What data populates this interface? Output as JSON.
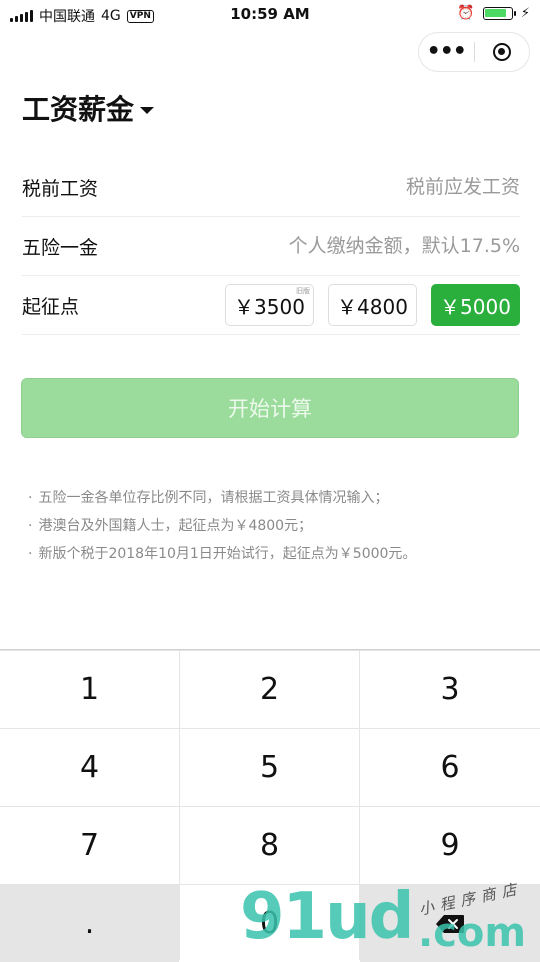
{
  "status_bar": {
    "carrier": "中国联通",
    "network": "4G",
    "vpn": "VPN",
    "time": "10:59 AM",
    "battery_level": 0.85,
    "battery_color": "#4cd964"
  },
  "capsule": {
    "more_glyph": "•••",
    "more_icon": "more-dots-icon",
    "close_icon": "target-circle-icon"
  },
  "header": {
    "title": "工资薪金",
    "dropdown_icon": "caret-down-icon"
  },
  "form": {
    "salary": {
      "label": "税前工资",
      "placeholder": "税前应发工资",
      "value": ""
    },
    "insurance": {
      "label": "五险一金",
      "placeholder": "个人缴纳金额，默认17.5%",
      "value": ""
    },
    "threshold": {
      "label": "起征点",
      "options": [
        {
          "label": "￥3500",
          "tag": "旧版",
          "selected": false
        },
        {
          "label": "￥4800",
          "tag": "",
          "selected": false
        },
        {
          "label": "￥5000",
          "tag": "",
          "selected": true
        }
      ]
    }
  },
  "start_button": {
    "label": "开始计算",
    "enabled": false
  },
  "notes": [
    "五险一金各单位存比例不同，请根据工资具体情况输入；",
    "港澳台及外国籍人士，起征点为￥4800元；",
    "新版个税于2018年10月1日开始试行，起征点为￥5000元。"
  ],
  "note_bullet": "·",
  "keypad": {
    "keys": [
      "1",
      "2",
      "3",
      "4",
      "5",
      "6",
      "7",
      "8",
      "9",
      ".",
      "0"
    ],
    "backspace_icon": "backspace-icon"
  },
  "watermark": {
    "main": "91ud",
    "suffix": ".com",
    "tagline": "小程序商店"
  },
  "colors": {
    "accent": "#2aae3c",
    "start_disabled": "#9bdc9c",
    "note_text": "#8a8a8a",
    "keypad_bg": "#e5e5e5"
  }
}
